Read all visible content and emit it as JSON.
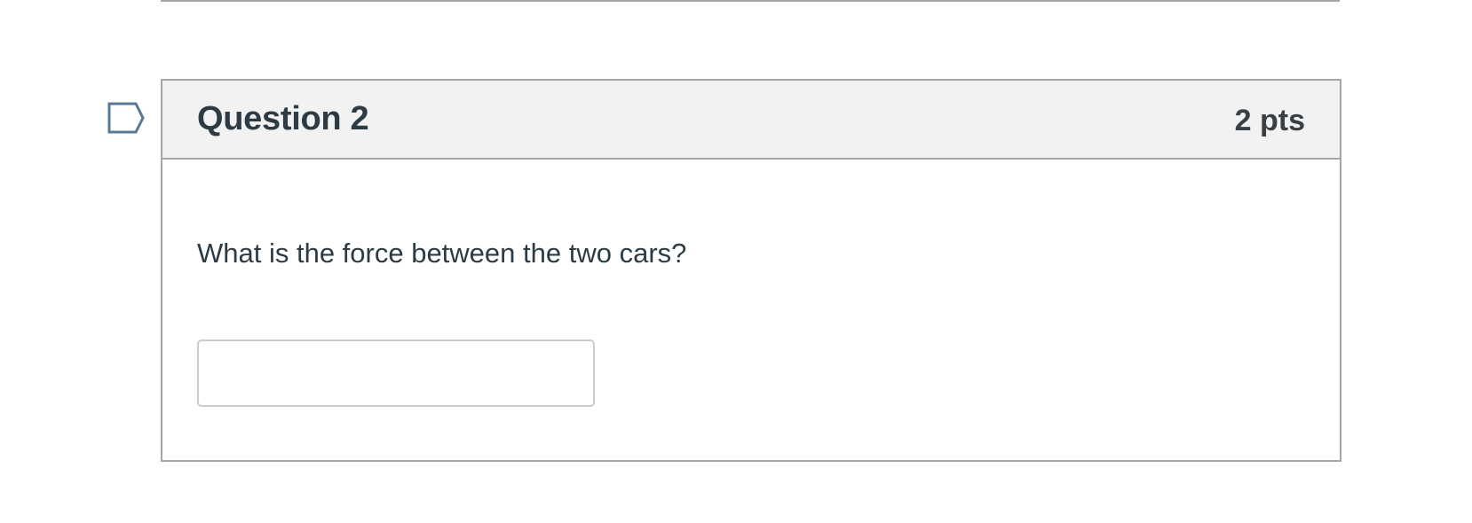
{
  "question": {
    "title": "Question 2",
    "points": "2 pts",
    "text": "What is the force between the two cars?",
    "answer": {
      "value": "",
      "placeholder": ""
    }
  },
  "icons": {
    "flag": "flag-outline-icon"
  },
  "colors": {
    "header_bg": "#f2f2f2",
    "border": "#a5a5a5",
    "text": "#2d3b45",
    "flag_stroke": "#5a7893"
  }
}
